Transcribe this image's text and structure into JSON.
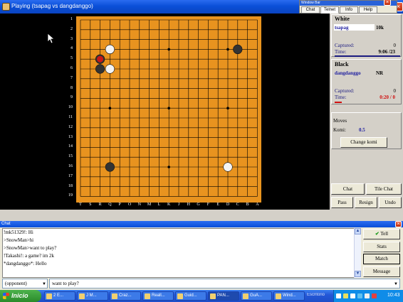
{
  "window": {
    "title": "Playing (tsapag vs dangdanggo)"
  },
  "window_bar": {
    "title": "Window Bar",
    "tabs": [
      "Chat",
      "Telnet",
      "Info",
      "Help"
    ],
    "active_tab": "Telnet"
  },
  "board": {
    "row_labels": [
      "1",
      "2",
      "3",
      "4",
      "5",
      "6",
      "7",
      "8",
      "9",
      "10",
      "11",
      "12",
      "13",
      "14",
      "15",
      "16",
      "17",
      "18",
      "19"
    ],
    "col_labels": [
      "T",
      "S",
      "R",
      "Q",
      "P",
      "O",
      "N",
      "M",
      "L",
      "K",
      "J",
      "H",
      "G",
      "F",
      "E",
      "D",
      "C",
      "B",
      "A"
    ],
    "stones": [
      {
        "color": "white",
        "col": "Q",
        "row": "4"
      },
      {
        "color": "black",
        "col": "C",
        "row": "4"
      },
      {
        "color": "black",
        "col": "R",
        "row": "5",
        "last_move": true
      },
      {
        "color": "black",
        "col": "R",
        "row": "6"
      },
      {
        "color": "white",
        "col": "Q",
        "row": "6"
      },
      {
        "color": "black",
        "col": "Q",
        "row": "16"
      },
      {
        "color": "white",
        "col": "D",
        "row": "16"
      }
    ]
  },
  "white_player": {
    "title": "White",
    "name": "tsapag",
    "rank": "10k",
    "captured_label": "Captured:",
    "captured": "0",
    "time_label": "Time:",
    "time": "9:06 /23"
  },
  "black_player": {
    "title": "Black",
    "name": "dangdanggo",
    "rank": "NR",
    "captured_label": "Captured:",
    "captured": "0",
    "time_label": "Time:",
    "time": "0:20 / 0"
  },
  "moves": {
    "label": "Moves",
    "komi_label": "Komi:",
    "komi": "0.5",
    "change_komi": "Change komi"
  },
  "panel_buttons": {
    "chat": "Chat",
    "tile_chat": "Tile Chat",
    "pass": "Pass",
    "resign": "Resign",
    "undo": "Undo"
  },
  "chat": {
    "title": "Chat",
    "lines": [
      "!mk51329!: Hi",
      ">SnowMan>hi",
      ">SnowMan>want to play?",
      "!Takashi!: a game? im 2k",
      "*dangdanggo*: Hello"
    ],
    "buttons": {
      "tell": "Tell",
      "stats": "Stats",
      "match": "Match",
      "message": "Message"
    },
    "target": "(opponent)",
    "input_value": "want to play?"
  },
  "taskbar": {
    "start": "Inicio",
    "tasks": [
      "2 E...",
      "J M...",
      "Craz...",
      "Reall...",
      "Guid...",
      "PAN...",
      "GuA...",
      "Wind..."
    ],
    "active_task": 5,
    "tray_label": "Escritorio",
    "clock": "10:43"
  },
  "colors": {
    "title_bar": "#0a4fd8",
    "board": "#e8931f",
    "last_move": "#c81818",
    "time_bar_white": "#1a1a80",
    "time_bar_black": "#d01010"
  }
}
